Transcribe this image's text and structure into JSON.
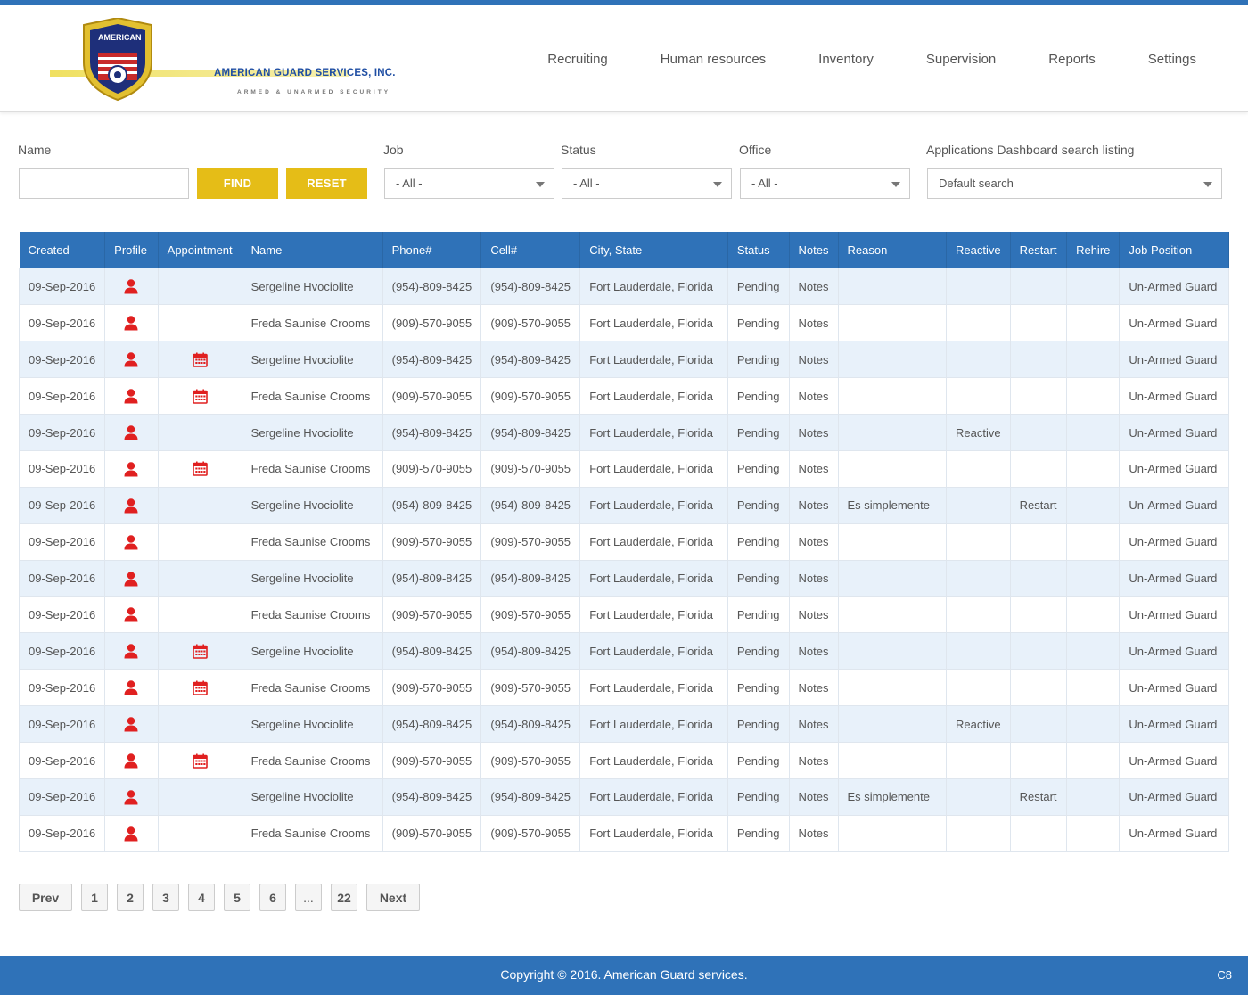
{
  "brand": {
    "badge_text": "AMERICAN",
    "company": "AMERICAN GUARD SERVICES, INC.",
    "tagline": "ARMED & UNARMED SECURITY"
  },
  "nav": [
    "Recruiting",
    "Human resources",
    "Inventory",
    "Supervision",
    "Reports",
    "Settings"
  ],
  "filters": {
    "name_label": "Name",
    "name_value": "",
    "find_label": "FIND",
    "reset_label": "RESET",
    "job_label": "Job",
    "job_value": "- All -",
    "status_label": "Status",
    "status_value": "- All -",
    "office_label": "Office",
    "office_value": "- All -",
    "search_label": "Applications Dashboard search listing",
    "search_value": "Default search"
  },
  "table": {
    "columns": [
      "Created",
      "Profile",
      "Appointment",
      "Name",
      "Phone#",
      "Cell#",
      "City, State",
      "Status",
      "Notes",
      "Reason",
      "Reactive",
      "Restart",
      "Rehire",
      "Job Position"
    ],
    "rows": [
      {
        "created": "09-Sep-2016",
        "appointment": false,
        "name": "Sergeline Hvociolite",
        "phone": "(954)-809-8425",
        "cell": "(954)-809-8425",
        "city": "Fort Lauderdale, Florida",
        "status": "Pending",
        "notes": "Notes",
        "reason": "",
        "reactive": "",
        "restart": "",
        "rehire": "",
        "job": "Un-Armed Guard"
      },
      {
        "created": "09-Sep-2016",
        "appointment": false,
        "name": "Freda Saunise Crooms",
        "phone": "(909)-570-9055",
        "cell": "(909)-570-9055",
        "city": "Fort Lauderdale, Florida",
        "status": "Pending",
        "notes": "Notes",
        "reason": "",
        "reactive": "",
        "restart": "",
        "rehire": "",
        "job": "Un-Armed Guard"
      },
      {
        "created": "09-Sep-2016",
        "appointment": true,
        "name": "Sergeline Hvociolite",
        "phone": "(954)-809-8425",
        "cell": "(954)-809-8425",
        "city": "Fort Lauderdale, Florida",
        "status": "Pending",
        "notes": "Notes",
        "reason": "",
        "reactive": "",
        "restart": "",
        "rehire": "",
        "job": "Un-Armed Guard"
      },
      {
        "created": "09-Sep-2016",
        "appointment": true,
        "name": "Freda Saunise Crooms",
        "phone": "(909)-570-9055",
        "cell": "(909)-570-9055",
        "city": "Fort Lauderdale, Florida",
        "status": "Pending",
        "notes": "Notes",
        "reason": "",
        "reactive": "",
        "restart": "",
        "rehire": "",
        "job": "Un-Armed Guard"
      },
      {
        "created": "09-Sep-2016",
        "appointment": false,
        "name": "Sergeline Hvociolite",
        "phone": "(954)-809-8425",
        "cell": "(954)-809-8425",
        "city": "Fort Lauderdale, Florida",
        "status": "Pending",
        "notes": "Notes",
        "reason": "",
        "reactive": "Reactive",
        "restart": "",
        "rehire": "",
        "job": "Un-Armed Guard"
      },
      {
        "created": "09-Sep-2016",
        "appointment": true,
        "name": "Freda Saunise Crooms",
        "phone": "(909)-570-9055",
        "cell": "(909)-570-9055",
        "city": "Fort Lauderdale, Florida",
        "status": "Pending",
        "notes": "Notes",
        "reason": "",
        "reactive": "",
        "restart": "",
        "rehire": "",
        "job": "Un-Armed Guard"
      },
      {
        "created": "09-Sep-2016",
        "appointment": false,
        "name": "Sergeline Hvociolite",
        "phone": "(954)-809-8425",
        "cell": "(954)-809-8425",
        "city": "Fort Lauderdale, Florida",
        "status": "Pending",
        "notes": "Notes",
        "reason": "Es simplemente",
        "reactive": "",
        "restart": "Restart",
        "rehire": "",
        "job": "Un-Armed Guard"
      },
      {
        "created": "09-Sep-2016",
        "appointment": false,
        "name": "Freda Saunise Crooms",
        "phone": "(909)-570-9055",
        "cell": "(909)-570-9055",
        "city": "Fort Lauderdale, Florida",
        "status": "Pending",
        "notes": "Notes",
        "reason": "",
        "reactive": "",
        "restart": "",
        "rehire": "",
        "job": "Un-Armed Guard"
      },
      {
        "created": "09-Sep-2016",
        "appointment": false,
        "name": "Sergeline Hvociolite",
        "phone": "(954)-809-8425",
        "cell": "(954)-809-8425",
        "city": "Fort Lauderdale, Florida",
        "status": "Pending",
        "notes": "Notes",
        "reason": "",
        "reactive": "",
        "restart": "",
        "rehire": "",
        "job": "Un-Armed Guard"
      },
      {
        "created": "09-Sep-2016",
        "appointment": false,
        "name": "Freda Saunise Crooms",
        "phone": "(909)-570-9055",
        "cell": "(909)-570-9055",
        "city": "Fort Lauderdale, Florida",
        "status": "Pending",
        "notes": "Notes",
        "reason": "",
        "reactive": "",
        "restart": "",
        "rehire": "",
        "job": "Un-Armed Guard"
      },
      {
        "created": "09-Sep-2016",
        "appointment": true,
        "name": "Sergeline Hvociolite",
        "phone": "(954)-809-8425",
        "cell": "(954)-809-8425",
        "city": "Fort Lauderdale, Florida",
        "status": "Pending",
        "notes": "Notes",
        "reason": "",
        "reactive": "",
        "restart": "",
        "rehire": "",
        "job": "Un-Armed Guard"
      },
      {
        "created": "09-Sep-2016",
        "appointment": true,
        "name": "Freda Saunise Crooms",
        "phone": "(909)-570-9055",
        "cell": "(909)-570-9055",
        "city": "Fort Lauderdale, Florida",
        "status": "Pending",
        "notes": "Notes",
        "reason": "",
        "reactive": "",
        "restart": "",
        "rehire": "",
        "job": "Un-Armed Guard"
      },
      {
        "created": "09-Sep-2016",
        "appointment": false,
        "name": "Sergeline Hvociolite",
        "phone": "(954)-809-8425",
        "cell": "(954)-809-8425",
        "city": "Fort Lauderdale, Florida",
        "status": "Pending",
        "notes": "Notes",
        "reason": "",
        "reactive": "Reactive",
        "restart": "",
        "rehire": "",
        "job": "Un-Armed Guard"
      },
      {
        "created": "09-Sep-2016",
        "appointment": true,
        "name": "Freda Saunise Crooms",
        "phone": "(909)-570-9055",
        "cell": "(909)-570-9055",
        "city": "Fort Lauderdale, Florida",
        "status": "Pending",
        "notes": "Notes",
        "reason": "",
        "reactive": "",
        "restart": "",
        "rehire": "",
        "job": "Un-Armed Guard"
      },
      {
        "created": "09-Sep-2016",
        "appointment": false,
        "name": "Sergeline Hvociolite",
        "phone": "(954)-809-8425",
        "cell": "(954)-809-8425",
        "city": "Fort Lauderdale, Florida",
        "status": "Pending",
        "notes": "Notes",
        "reason": "Es simplemente",
        "reactive": "",
        "restart": "Restart",
        "rehire": "",
        "job": "Un-Armed Guard"
      },
      {
        "created": "09-Sep-2016",
        "appointment": false,
        "name": "Freda Saunise Crooms",
        "phone": "(909)-570-9055",
        "cell": "(909)-570-9055",
        "city": "Fort Lauderdale, Florida",
        "status": "Pending",
        "notes": "Notes",
        "reason": "",
        "reactive": "",
        "restart": "",
        "rehire": "",
        "job": "Un-Armed Guard"
      }
    ]
  },
  "pagination": {
    "prev": "Prev",
    "pages": [
      "1",
      "2",
      "3",
      "4",
      "5",
      "6",
      "...",
      "22"
    ],
    "next": "Next"
  },
  "footer": {
    "copyright": "Copyright © 2016. American Guard services.",
    "code": "C8"
  },
  "colors": {
    "primary": "#2f72b8",
    "accent": "#e5bd17",
    "icon_red": "#e02020",
    "row_alt": "#e8f1fa"
  },
  "icons": {
    "profile": "user-icon",
    "appointment": "calendar-icon",
    "dropdown": "chevron-down-icon"
  }
}
